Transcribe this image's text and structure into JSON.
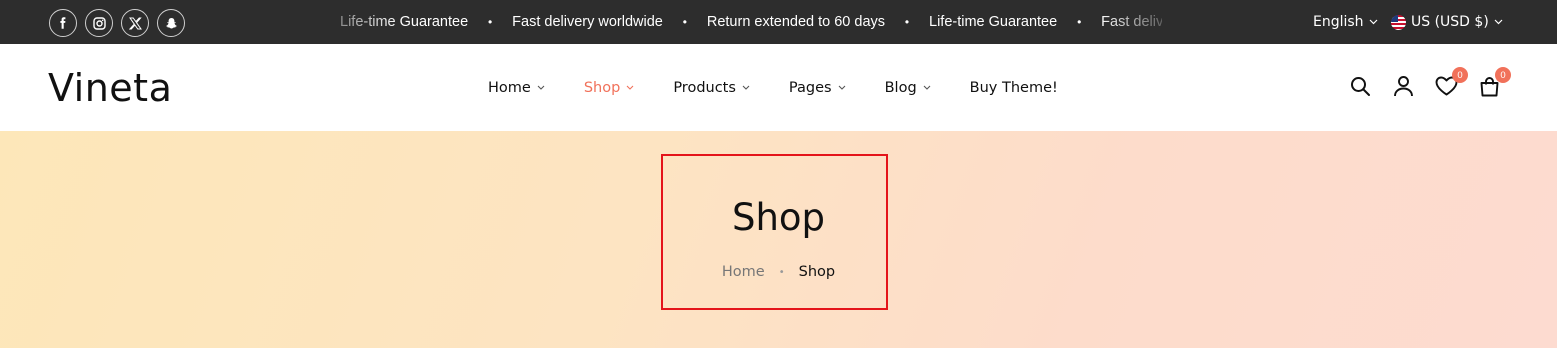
{
  "topbar": {
    "socials": [
      {
        "icon": "facebook-icon"
      },
      {
        "icon": "instagram-icon"
      },
      {
        "icon": "x-twitter-icon"
      },
      {
        "icon": "snapchat-icon"
      }
    ],
    "marquee": [
      "Life-time Guarantee",
      "•",
      "Fast delivery worldwide",
      "•",
      "Return extended to 60 days",
      "•",
      "Life-time Guarantee",
      "•",
      "Fast delivery worldwide"
    ],
    "language": "English",
    "currency": "US (USD $)"
  },
  "header": {
    "logo": "Vineta",
    "nav": [
      {
        "label": "Home",
        "has_dropdown": true,
        "active": false
      },
      {
        "label": "Shop",
        "has_dropdown": true,
        "active": true
      },
      {
        "label": "Products",
        "has_dropdown": true,
        "active": false
      },
      {
        "label": "Pages",
        "has_dropdown": true,
        "active": false
      },
      {
        "label": "Blog",
        "has_dropdown": true,
        "active": false
      },
      {
        "label": "Buy Theme!",
        "has_dropdown": false,
        "active": false
      }
    ],
    "wishlist_count": "0",
    "cart_count": "0"
  },
  "banner": {
    "title": "Shop",
    "breadcrumb_home": "Home",
    "breadcrumb_separator": "•",
    "breadcrumb_current": "Shop"
  },
  "colors": {
    "accent": "#f1715a",
    "topbar_bg": "#2d2d2d",
    "highlight_border": "#e4141a"
  }
}
